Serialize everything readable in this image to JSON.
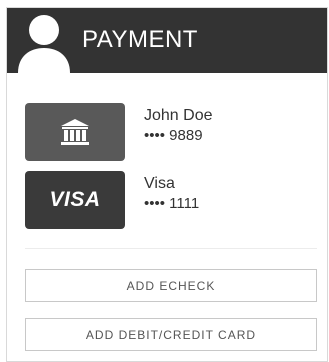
{
  "header": {
    "title": "PAYMENT",
    "avatar_icon": "user-avatar-icon",
    "background": "#333333"
  },
  "payment_methods": [
    {
      "type": "bank",
      "icon": "bank-icon",
      "name": "John Doe",
      "number": "•••• 9889"
    },
    {
      "type": "card",
      "icon": "visa-icon",
      "icon_text": "VISA",
      "name": "Visa",
      "number": "•••• 1111"
    }
  ],
  "actions": {
    "add_echeck": "ADD ECHECK",
    "add_card": "ADD DEBIT/CREDIT CARD"
  }
}
